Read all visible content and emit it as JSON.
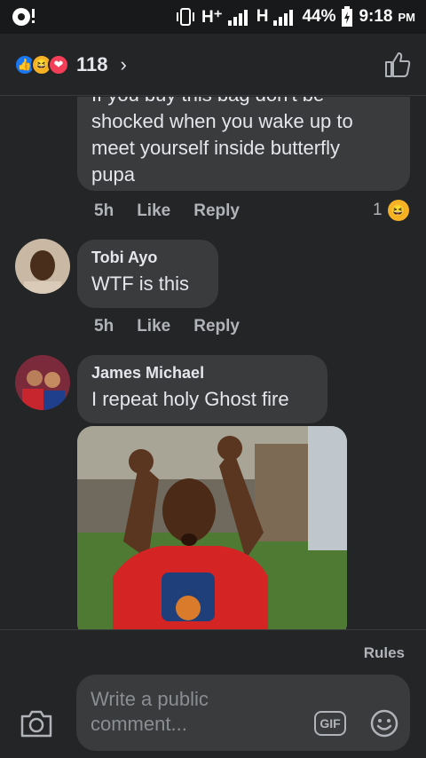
{
  "status_bar": {
    "network1": "H⁺",
    "network2": "H",
    "battery": "44%",
    "time": "9:18",
    "ampm": "PM"
  },
  "header": {
    "reaction_icons": [
      "like-icon",
      "haha-icon",
      "love-icon"
    ],
    "reaction_count": "118",
    "chevron": "›"
  },
  "comments": [
    {
      "name": "",
      "text_lines": [
        "If you buy this bag don't be",
        "shocked when you wake up to",
        "meet yourself inside butterfly",
        "pupa"
      ],
      "time": "5h",
      "like_label": "Like",
      "reply_label": "Reply",
      "reaction_count": "1",
      "reaction_icon": "haha-icon"
    },
    {
      "name": "Tobi Ayo",
      "text": "WTF is this",
      "time": "5h",
      "like_label": "Like",
      "reply_label": "Reply"
    },
    {
      "name": "James Michael",
      "text": "I repeat holy Ghost fire",
      "image": "man-raising-fists-photo"
    }
  ],
  "footer": {
    "rules_label": "Rules",
    "placeholder": "Write a public comment...",
    "gif_label": "GIF",
    "camera_icon": "camera-icon",
    "emoji_icon": "smiley-icon"
  },
  "colors": {
    "background": "#242526",
    "bubble": "#3a3b3c",
    "like": "#1877f2",
    "haha": "#f7b125",
    "love": "#f33e58"
  }
}
